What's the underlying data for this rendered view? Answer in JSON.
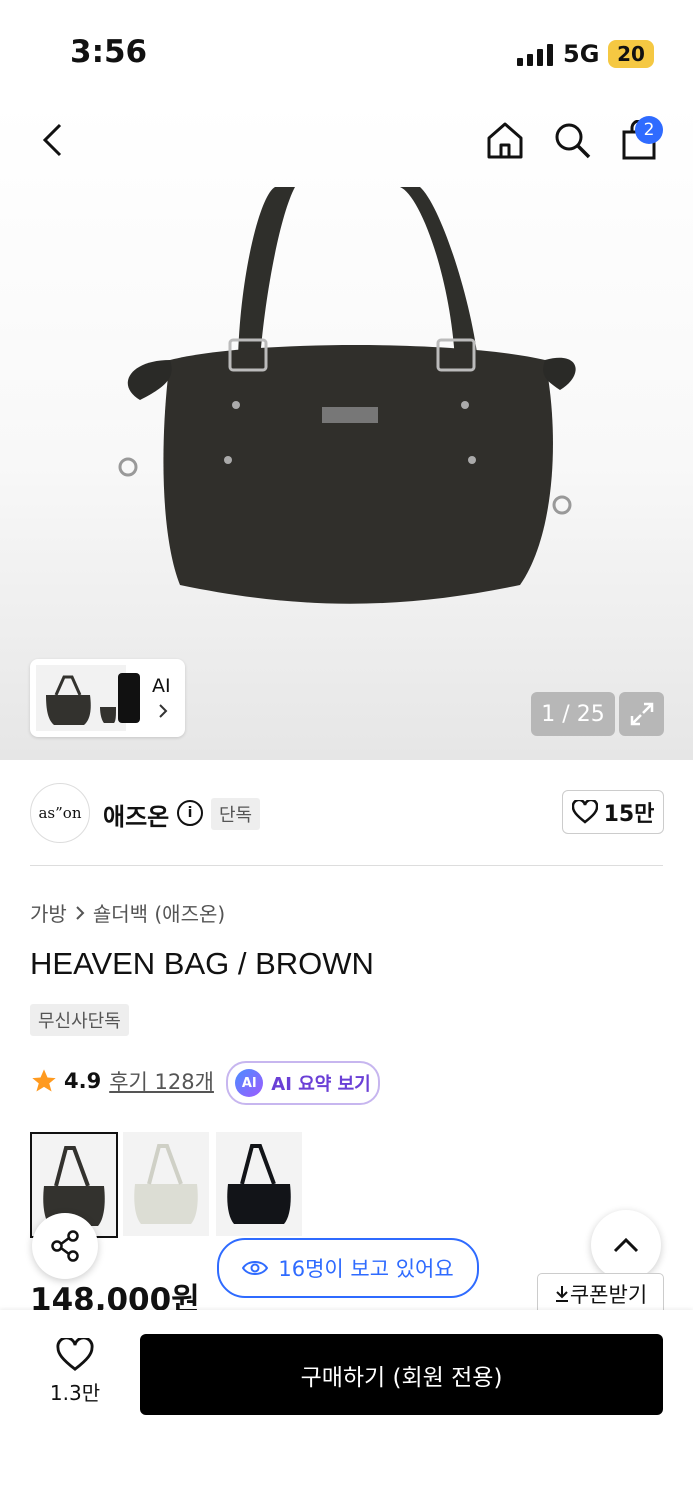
{
  "status": {
    "time": "3:56",
    "network": "5G",
    "battery": "20"
  },
  "nav": {
    "cart_count": "2"
  },
  "gallery": {
    "ai_label": "AI",
    "counter": "1 / 25"
  },
  "brand": {
    "logo_text": "as”on",
    "name": "애즈온",
    "exclusive_tag": "단독",
    "likes": "15만"
  },
  "breadcrumb": {
    "category": "가방",
    "subcategory": "숄더백 (애즈온)"
  },
  "product": {
    "title": "HEAVEN BAG / BROWN",
    "badge": "무신사단독",
    "rating": "4.9",
    "reviews": "후기 128개",
    "ai_summary": "AI 요약 보기",
    "ai_icon": "AI",
    "price": "148,000원"
  },
  "viewers": "16명이 보고 있어요",
  "coupon": "쿠폰받기",
  "bottom": {
    "wish_count": "1.3만",
    "buy_label": "구매하기 (회원 전용)"
  },
  "colors": {
    "accent": "#2f6bff",
    "ai_purple": "#6a3fd6",
    "star": "#ff9a1f",
    "battery": "#f5c842"
  }
}
